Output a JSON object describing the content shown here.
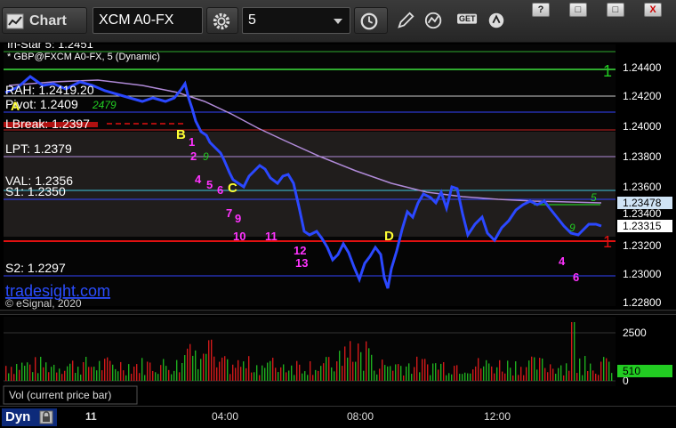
{
  "toolbar": {
    "title": "Chart",
    "symbol": "XCM A0-FX",
    "interval": "5",
    "get_label": "GET",
    "window_controls": [
      "?",
      "□",
      "□",
      "X"
    ]
  },
  "chart": {
    "study_line1": "In-Star 5: 1.2451",
    "study_line2": "* GBP@FXCM A0-FX, 5 (Dynamic)",
    "watermark": "tradesight.com",
    "copyright": "© eSignal, 2020",
    "levels": [
      {
        "label": "RAH: 1.2419.20",
        "color": "#ffffff"
      },
      {
        "label": "Pivot: 1.2409",
        "color": "#ffffff"
      },
      {
        "label": "LBreak: 1.2397",
        "color": "#ffffff"
      },
      {
        "label": "LPT: 1.2379",
        "color": "#ffffff"
      },
      {
        "label": "VAL: 1.2356",
        "color": "#ffffff"
      },
      {
        "label": "S1: 1.2350",
        "color": "#ffffff"
      },
      {
        "label": "S2: 1.2297",
        "color": "#ffffff"
      }
    ],
    "price_axis": [
      "1.24400",
      "1.24200",
      "1.24000",
      "1.23800",
      "1.23600",
      "1.23400",
      "1.23200",
      "1.23000",
      "1.22800"
    ],
    "price_tags": [
      {
        "value": "1.23478",
        "bg": "#cfe3f5",
        "fg": "#000000"
      },
      {
        "value": "1.23315",
        "bg": "#ffffff",
        "fg": "#000000"
      }
    ],
    "axis_one_markers": [
      "1",
      "1"
    ],
    "markers": [
      "A",
      "B",
      "C",
      "D"
    ],
    "magenta_counts": [
      "1",
      "2",
      "4",
      "5",
      "6",
      "7",
      "9",
      "10",
      "11",
      "12",
      "13",
      "4",
      "6"
    ],
    "green_counts": [
      "9",
      "5",
      "9"
    ],
    "green_text": "2479",
    "colors": {
      "background": "#000000",
      "price_line": "#1f3cff",
      "ma_line": "#b08ad8",
      "red_level": "#e01010",
      "marker_yellow": "#ffff33",
      "count_magenta": "#ff33ff",
      "count_green": "#22cc22"
    }
  },
  "volume": {
    "label": "Vol (current price bar)",
    "axis": [
      "2500",
      "0"
    ],
    "current_tag": "510"
  },
  "time_axis": {
    "day": "11",
    "labels": [
      "04:00",
      "08:00",
      "12:00"
    ]
  },
  "bottom": {
    "dyn_label": "Dyn"
  }
}
